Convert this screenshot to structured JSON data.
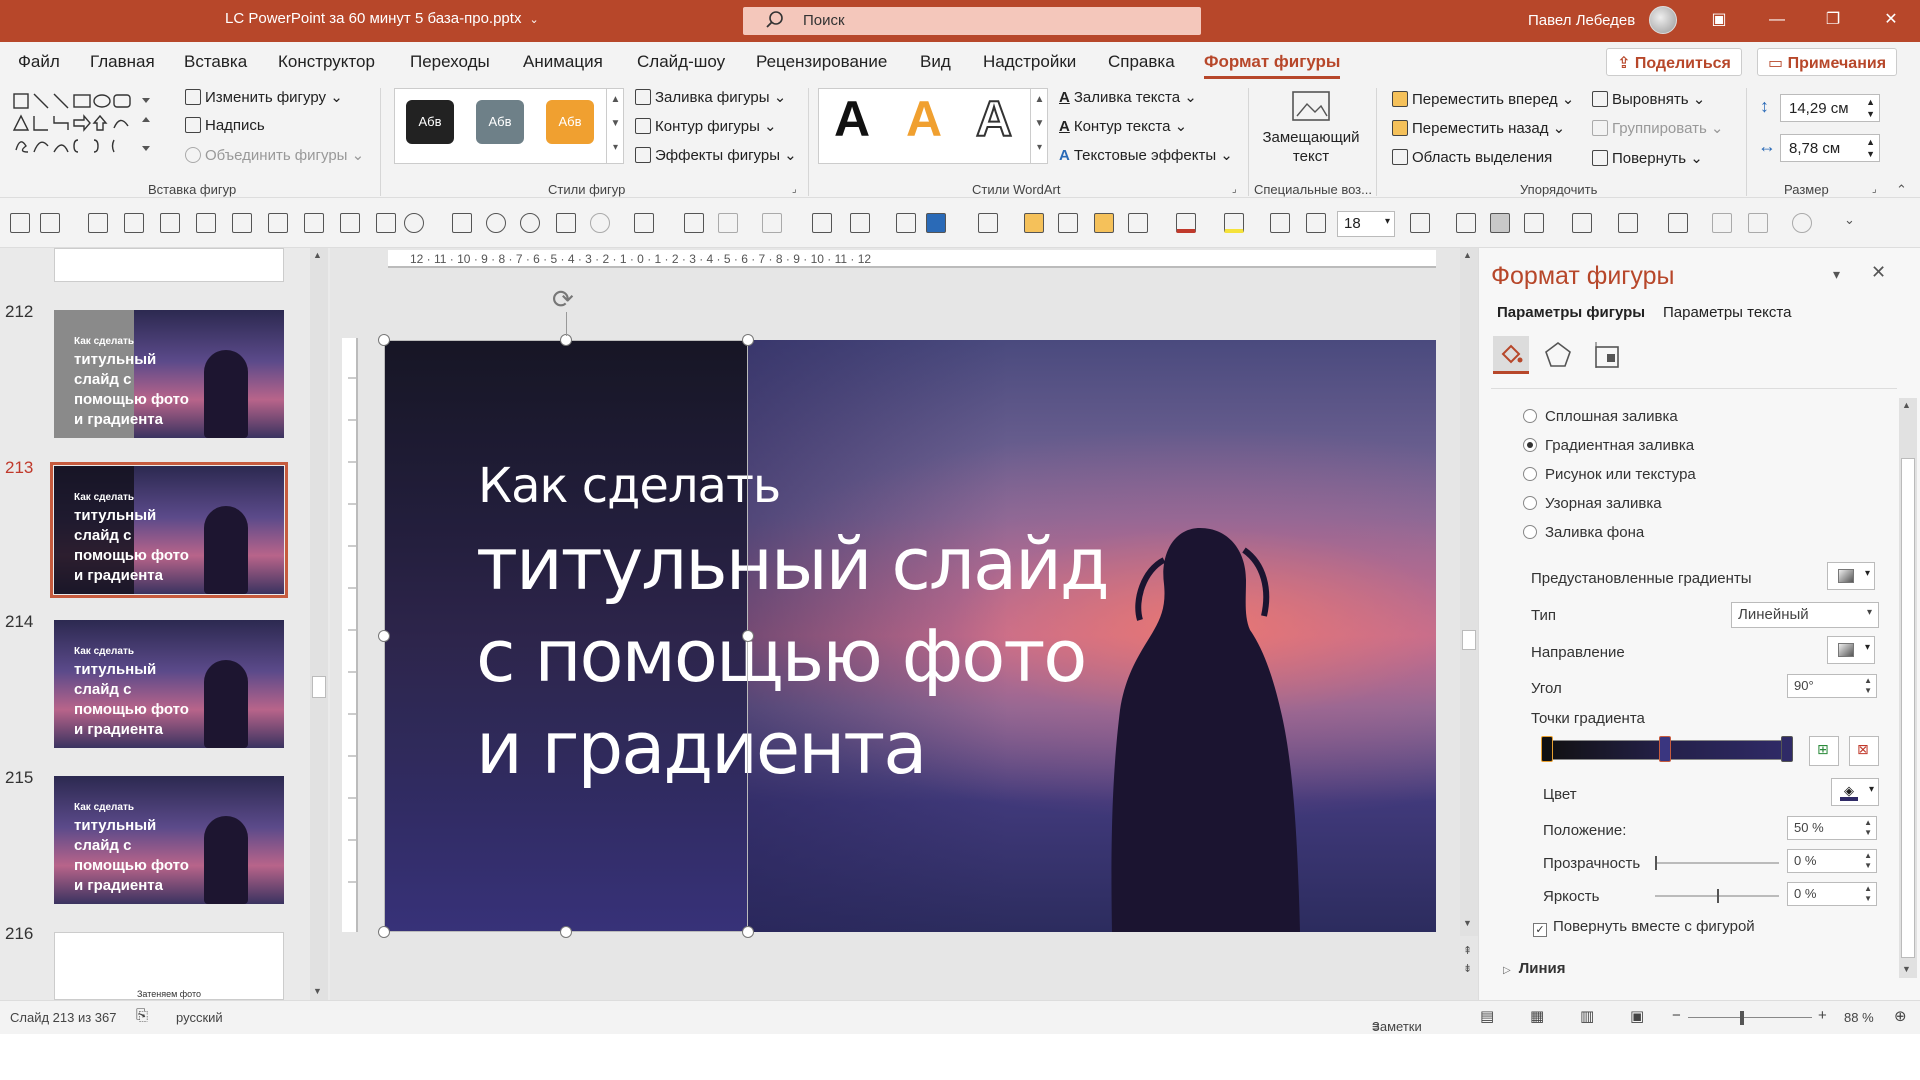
{
  "titlebar": {
    "doc_title": "LC PowerPoint за 60 минут 5 база-про.pptx",
    "search_placeholder": "Поиск",
    "user_name": "Павел Лебедев"
  },
  "menu": {
    "tabs": [
      "Файл",
      "Главная",
      "Вставка",
      "Конструктор",
      "Переходы",
      "Анимация",
      "Слайд-шоу",
      "Рецензирование",
      "Вид",
      "Надстройки",
      "Справка",
      "Формат фигуры"
    ],
    "active_tab": "Формат фигуры",
    "share_label": "Поделиться",
    "comments_label": "Примечания"
  },
  "ribbon": {
    "insert_shapes": {
      "label": "Вставка фигур",
      "edit_shape": "Изменить фигуру",
      "text_box": "Надпись",
      "merge_shapes": "Объединить фигуры"
    },
    "shape_styles": {
      "label": "Стили фигур",
      "style_text": "Абв",
      "fill": "Заливка фигуры",
      "outline": "Контур фигуры",
      "effects": "Эффекты фигуры"
    },
    "wordart": {
      "label": "Стили WordArt",
      "sample": "A",
      "text_fill": "Заливка текста",
      "text_outline": "Контур текста",
      "text_effects": "Текстовые эффекты"
    },
    "accessibility": {
      "label": "Специальные воз...",
      "alt_text_line1": "Замещающий",
      "alt_text_line2": "текст"
    },
    "arrange": {
      "label": "Упорядочить",
      "bring_forward": "Переместить вперед",
      "send_backward": "Переместить назад",
      "selection_pane": "Область выделения",
      "align": "Выровнять",
      "group": "Группировать",
      "rotate": "Повернуть"
    },
    "size": {
      "label": "Размер",
      "height": "14,29 см",
      "width": "8,78 см"
    }
  },
  "toolbar": {
    "font_size": "18"
  },
  "thumbnails": [
    {
      "num": "212",
      "l1": "Как сделать",
      "l2": "титульный слайд с помощью фото и градиента",
      "variant": "gray",
      "selected": false
    },
    {
      "num": "213",
      "l1": "Как сделать",
      "l2": "титульный слайд с помощью фото и градиента",
      "variant": "dark",
      "selected": true
    },
    {
      "num": "214",
      "l1": "Как сделать",
      "l2": "титульный слайд с помощью фото и градиента",
      "variant": "plain",
      "selected": false
    },
    {
      "num": "215",
      "l1": "Как сделать",
      "l2": "титульный слайд с помощью фото и градиента",
      "variant": "plain",
      "selected": false
    },
    {
      "num": "216",
      "l1": "Затеняем фото",
      "l2": "",
      "variant": "white",
      "selected": false
    }
  ],
  "slide": {
    "line1": "Как сделать",
    "line2": "титульный слайд",
    "line3": "с помощью фото",
    "line4": "и градиента"
  },
  "format_pane": {
    "title": "Формат фигуры",
    "tab_shape": "Параметры фигуры",
    "tab_text": "Параметры текста",
    "fill_options": [
      {
        "label": "Сплошная заливка",
        "checked": false
      },
      {
        "label": "Градиентная заливка",
        "checked": true
      },
      {
        "label": "Рисунок или текстура",
        "checked": false
      },
      {
        "label": "Узорная заливка",
        "checked": false
      },
      {
        "label": "Заливка фона",
        "checked": false
      }
    ],
    "preset_gradients": "Предустановленные градиенты",
    "type_label": "Тип",
    "type_value": "Линейный",
    "direction_label": "Направление",
    "angle_label": "Угол",
    "angle_value": "90°",
    "stops_label": "Точки градиента",
    "color_label": "Цвет",
    "position_label": "Положение:",
    "position_value": "50 %",
    "transparency_label": "Прозрачность",
    "transparency_value": "0 %",
    "brightness_label": "Яркость",
    "brightness_value": "0 %",
    "rotate_with_shape": "Повернуть вместе с фигурой",
    "line_section": "Линия"
  },
  "status": {
    "slide_info": "Слайд 213 из 367",
    "language": "русский",
    "notes": "Заметки",
    "zoom": "88 %"
  },
  "colors": {
    "accent": "#b7472a",
    "titlebar": "#b7472a"
  }
}
